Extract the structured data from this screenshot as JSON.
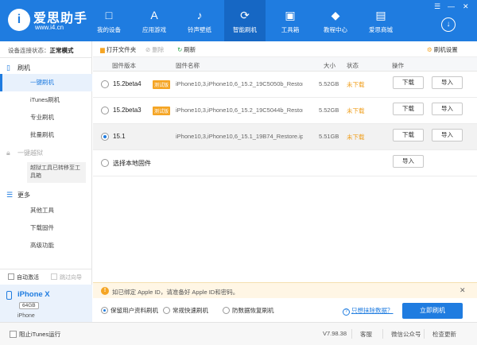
{
  "app": {
    "brand": "爱思助手",
    "url": "www.i4.cn",
    "window_controls": [
      "☰",
      "—",
      "✕"
    ],
    "download_icon": "download-icon"
  },
  "nav": [
    {
      "label": "我的设备",
      "icon": "□",
      "active": false
    },
    {
      "label": "应用游戏",
      "icon": "A",
      "active": false
    },
    {
      "label": "铃声壁纸",
      "icon": "♪",
      "active": false
    },
    {
      "label": "智能刷机",
      "icon": "⟳",
      "active": true
    },
    {
      "label": "工具箱",
      "icon": "▣",
      "active": false
    },
    {
      "label": "教程中心",
      "icon": "◆",
      "active": false
    },
    {
      "label": "爱思商城",
      "icon": "▤",
      "active": false
    }
  ],
  "sidebar": {
    "status_label": "设备连接状态：",
    "status_value": "正常模式",
    "flash_group": "刷机",
    "flash_items": [
      "一键刷机",
      "iTunes刷机",
      "专业刷机",
      "批量刷机"
    ],
    "jailbreak_group": "一键越狱",
    "jailbreak_notice": "越狱工具已转移至工具箱",
    "more_group": "更多",
    "more_items": [
      "其他工具",
      "下载固件",
      "高级功能"
    ],
    "auto_activate": "自动激活",
    "skip_guide": "跳过向导"
  },
  "device": {
    "name": "iPhone X",
    "capacity": "64GB",
    "model": "iPhone"
  },
  "toolbar": {
    "open_folder": "打开文件夹",
    "delete": "删除",
    "refresh": "刷新",
    "flash_settings": "刷机设置"
  },
  "table": {
    "headers": [
      "固件版本",
      "固件名称",
      "大小",
      "状态",
      "操作"
    ],
    "rows": [
      {
        "version": "15.2beta4",
        "beta_badge": "测试版",
        "name": "iPhone10,3,iPhone10,6_15.2_19C5050b_Restore.ipsw",
        "size": "5.52GB",
        "status": "未下载",
        "download": "下载",
        "import": "导入",
        "selected": false
      },
      {
        "version": "15.2beta3",
        "beta_badge": "测试版",
        "name": "iPhone10,3,iPhone10,6_15.2_19C5044b_Restore.ipsw",
        "size": "5.52GB",
        "status": "未下载",
        "download": "下载",
        "import": "导入",
        "selected": false
      },
      {
        "version": "15.1",
        "beta_badge": "",
        "name": "iPhone10,3,iPhone10,6_15.1_19B74_Restore.ipsw",
        "size": "5.51GB",
        "status": "未下载",
        "download": "下载",
        "import": "导入",
        "selected": true
      }
    ],
    "local_firmware": "选择本地固件",
    "local_import": "导入"
  },
  "alert": {
    "text": "如已绑定 Apple ID，请准备好 Apple ID和密码。"
  },
  "options": {
    "keep_data": "保留用户资料刷机",
    "quick": "常规快速刷机",
    "anti_recovery": "防数据恢复刷机",
    "help": "只想抹除数据？",
    "flash_now": "立即刷机"
  },
  "status_bar": {
    "block_itunes": "阻止iTunes运行",
    "version": "V7.98.38",
    "feedback": "客服",
    "wechat": "微信公众号",
    "check_update": "检查更新"
  },
  "colors": {
    "primary": "#1f7ce0",
    "warning": "#f5a524",
    "status_text": "#f0a020"
  }
}
